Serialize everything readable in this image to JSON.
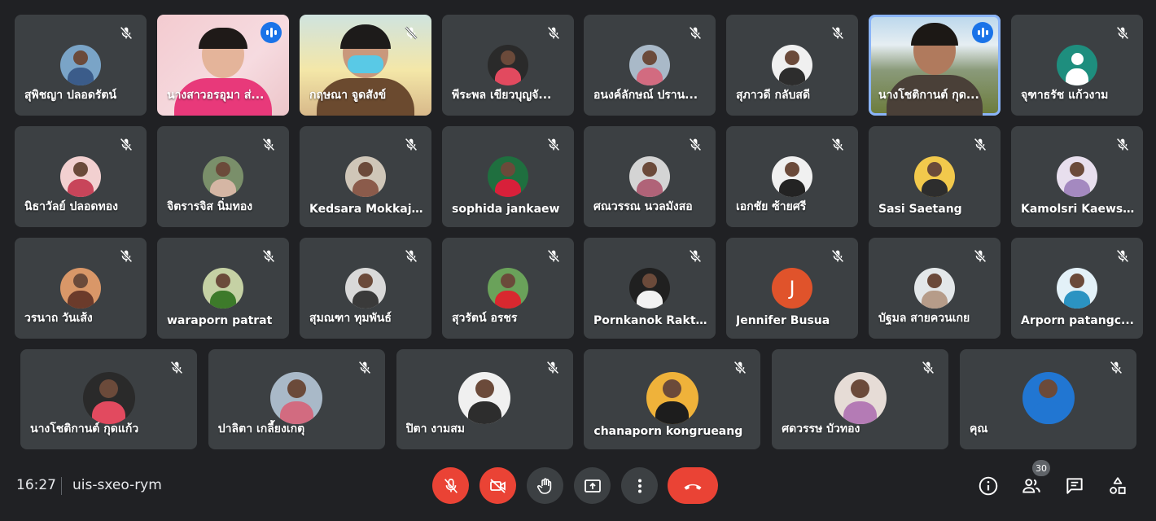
{
  "meeting": {
    "time": "16:27",
    "code": "uis-sxeo-rym",
    "participant_count": "30"
  },
  "participants": [
    {
      "name": "สุพิชญา ปลอดรัตน์",
      "status": "muted"
    },
    {
      "name": "นางสาวอรอุมา ส่...",
      "status": "speaking"
    },
    {
      "name": "กฤษณา จูดสังข์",
      "status": "muted"
    },
    {
      "name": "พีระพล เขียวบุญจั...",
      "status": "muted"
    },
    {
      "name": "อนงค์ลักษณ์ ปราน...",
      "status": "muted"
    },
    {
      "name": "สุภาวดี กลับสดี",
      "status": "muted"
    },
    {
      "name": "นางโชติกานต์ กุด...",
      "status": "speaking"
    },
    {
      "name": "จุฑาธรัช แก้วงาม",
      "status": "muted"
    },
    {
      "name": "นิธาวัลย์ ปลอดทอง",
      "status": "muted"
    },
    {
      "name": "จิตรารจิส นิ่มทอง",
      "status": "muted"
    },
    {
      "name": "Kedsara Mokkajan",
      "status": "muted"
    },
    {
      "name": "sophida jankaew",
      "status": "muted"
    },
    {
      "name": "ศณวรรณ นวลมังสอ",
      "status": "muted"
    },
    {
      "name": "เอกชัย ซ้ายศรี",
      "status": "muted"
    },
    {
      "name": "Sasi Saetang",
      "status": "muted"
    },
    {
      "name": "Kamolsri Kaews...",
      "status": "muted"
    },
    {
      "name": "วรนาถ วันเส้ง",
      "status": "muted"
    },
    {
      "name": "waraporn patrat",
      "status": "muted"
    },
    {
      "name": "สุมณฑา ทุมพันธ์",
      "status": "muted"
    },
    {
      "name": "สุวรัตน์ อรชร",
      "status": "muted"
    },
    {
      "name": "Pornkanok Rakt...",
      "status": "muted"
    },
    {
      "name": "Jennifer Busua",
      "status": "muted",
      "initial": "J"
    },
    {
      "name": "บัฐมล สายควนเกย",
      "status": "muted"
    },
    {
      "name": "Arporn patangc...",
      "status": "muted"
    },
    {
      "name": "นางโชติกานต์ กุดแก้ว",
      "status": "muted"
    },
    {
      "name": "ปาลิตา เกลี้ยงเกตุ",
      "status": "muted"
    },
    {
      "name": "ปิตา งามสม",
      "status": "muted"
    },
    {
      "name": "chanaporn kongrueang",
      "status": "muted"
    },
    {
      "name": "ศดวรรษ บัวทอง",
      "status": "muted"
    },
    {
      "name": "คุณ",
      "status": "muted"
    }
  ],
  "controls": {
    "mic": "mic-off",
    "camera": "camera-off",
    "raise_hand": "hand-icon",
    "present": "present-screen-icon",
    "more": "more-options-icon",
    "leave": "end-call-icon"
  },
  "colors": {
    "background": "#202124",
    "tile": "#3c4043",
    "danger": "#ea4335",
    "accent": "#1a73e8",
    "highlight": "#8ab4f8"
  }
}
